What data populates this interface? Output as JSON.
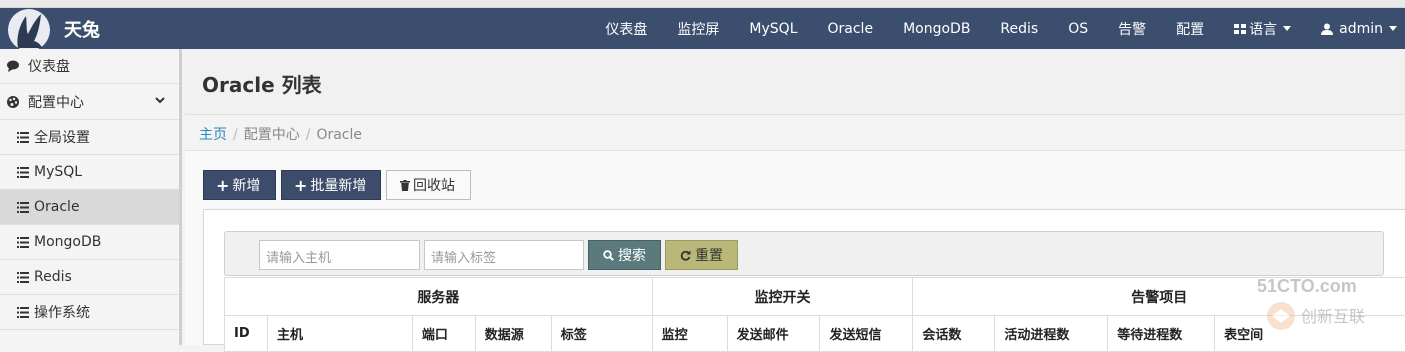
{
  "navbar": {
    "brand": "天兔",
    "items": [
      "仪表盘",
      "监控屏",
      "MySQL",
      "Oracle",
      "MongoDB",
      "Redis",
      "OS",
      "告警",
      "配置"
    ],
    "language_label": "语言",
    "user_label": "admin"
  },
  "sidebar": {
    "top_items": [
      {
        "label": "仪表盘",
        "icon": "comment-icon"
      },
      {
        "label": "配置中心",
        "icon": "palette-icon"
      }
    ],
    "sub_items": [
      "全局设置",
      "MySQL",
      "Oracle",
      "MongoDB",
      "Redis",
      "操作系统"
    ],
    "active": "Oracle"
  },
  "page": {
    "title": "Oracle 列表",
    "breadcrumb": [
      "主页",
      "配置中心",
      "Oracle"
    ]
  },
  "toolbar": {
    "add_label": "新增",
    "batch_add_label": "批量新增",
    "recycle_label": "回收站"
  },
  "search": {
    "host_placeholder": "请输入主机",
    "tag_placeholder": "请输入标签",
    "search_label": "搜索",
    "reset_label": "重置"
  },
  "table": {
    "groups": [
      "服务器",
      "监控开关",
      "告警项目"
    ],
    "columns": [
      "ID",
      "主机",
      "端口",
      "数据源",
      "标签",
      "监控",
      "发送邮件",
      "发送短信",
      "会话数",
      "活动进程数",
      "等待进程数",
      "表空间"
    ]
  },
  "watermark": {
    "line1": "51CTO.com",
    "line2": "创新互联"
  },
  "colors": {
    "navbar": "#3b4e6e",
    "dark_button": "#3c4c6a",
    "search_button": "#5a7a7c",
    "reset_button": "#b9b879",
    "link": "#2a8ab8"
  }
}
